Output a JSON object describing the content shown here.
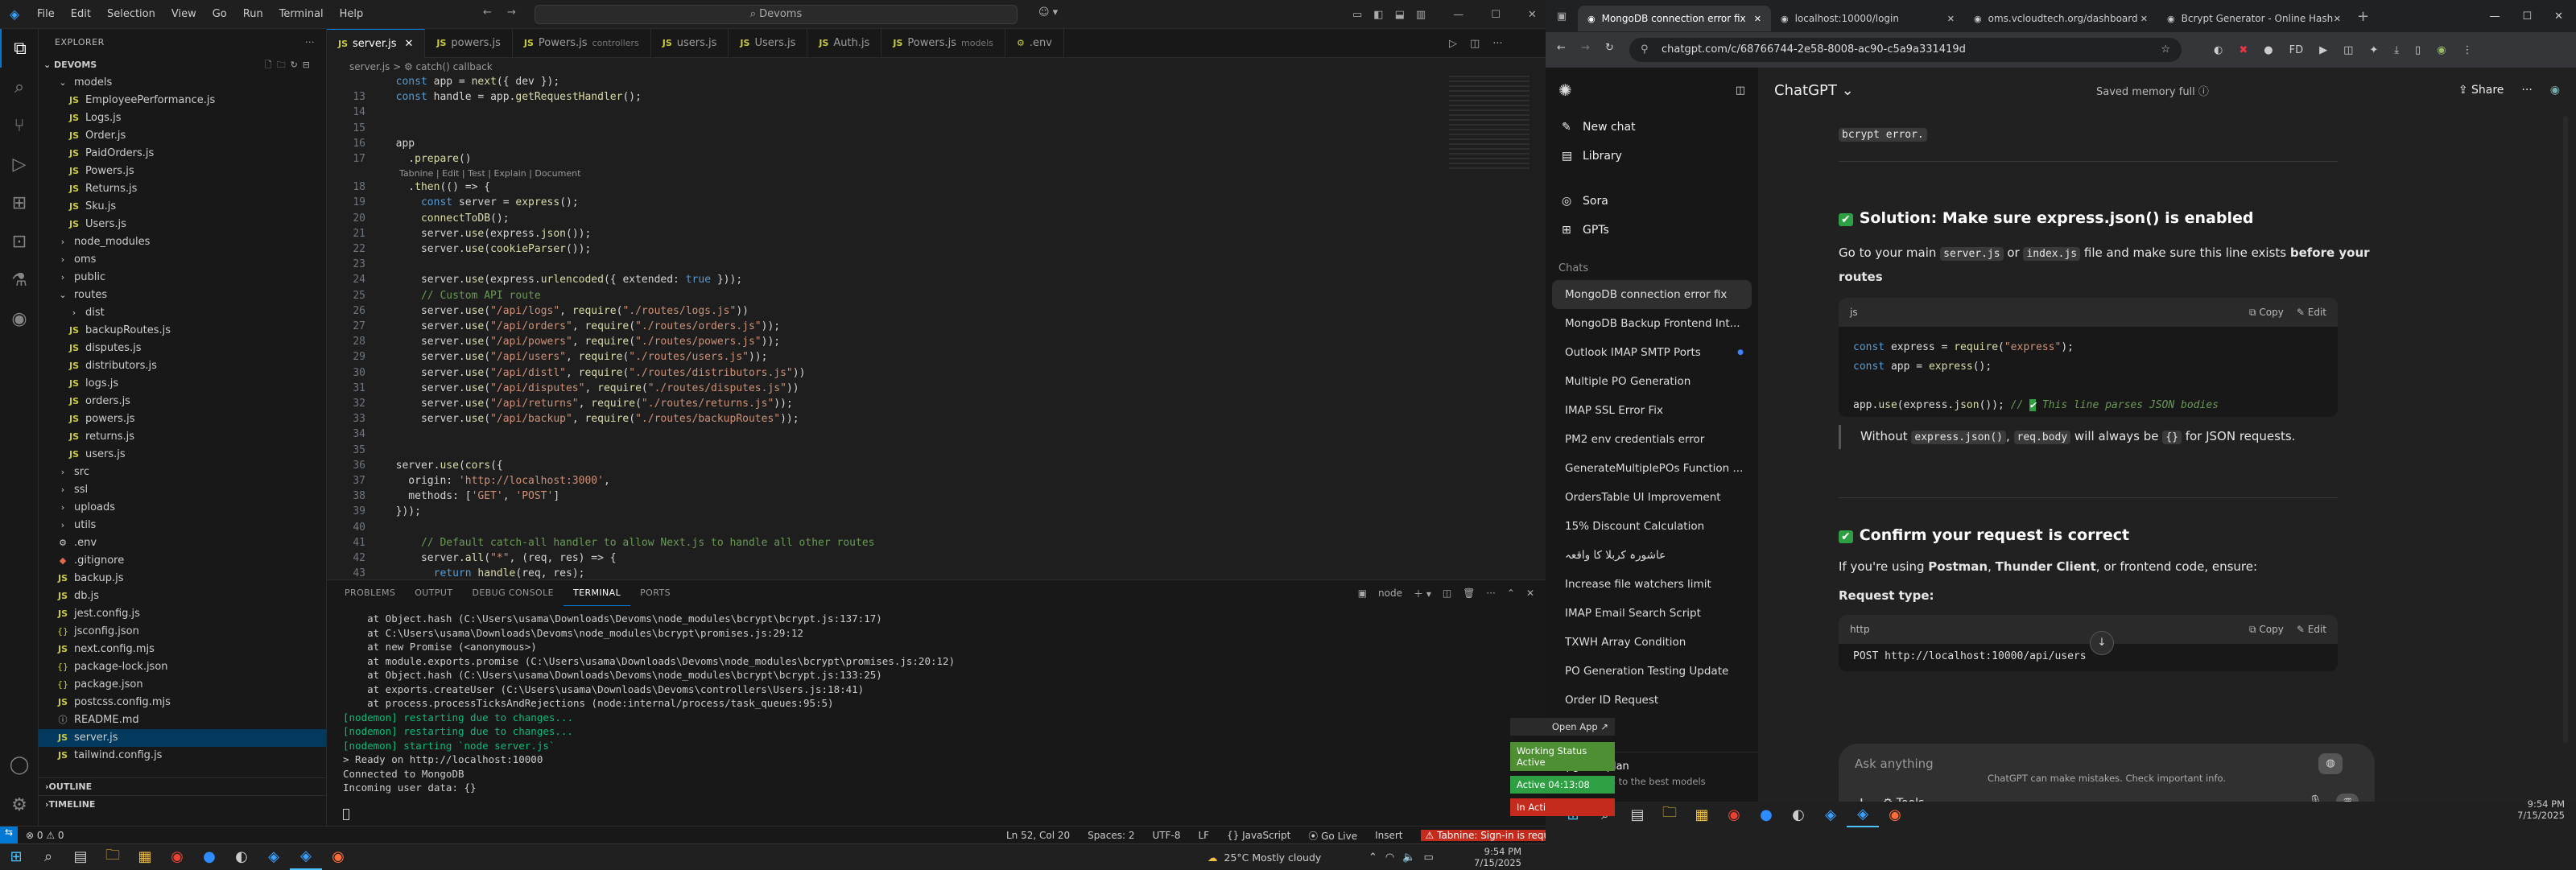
{
  "vscode": {
    "menu": [
      "File",
      "Edit",
      "Selection",
      "View",
      "Go",
      "Run",
      "Terminal",
      "Help"
    ],
    "search": "Devoms",
    "explorer_title": "EXPLORER",
    "root": "DEVOMS",
    "tree": [
      {
        "indent": 1,
        "type": "folder",
        "open": true,
        "name": "models"
      },
      {
        "indent": 2,
        "type": "js",
        "name": "EmployeePerformance.js"
      },
      {
        "indent": 2,
        "type": "js",
        "name": "Logs.js"
      },
      {
        "indent": 2,
        "type": "js",
        "name": "Order.js"
      },
      {
        "indent": 2,
        "type": "js",
        "name": "PaidOrders.js"
      },
      {
        "indent": 2,
        "type": "js",
        "name": "Powers.js"
      },
      {
        "indent": 2,
        "type": "js",
        "name": "Returns.js"
      },
      {
        "indent": 2,
        "type": "js",
        "name": "Sku.js"
      },
      {
        "indent": 2,
        "type": "js",
        "name": "Users.js"
      },
      {
        "indent": 1,
        "type": "folder",
        "open": false,
        "name": "node_modules"
      },
      {
        "indent": 1,
        "type": "folder",
        "open": false,
        "name": "oms"
      },
      {
        "indent": 1,
        "type": "folder",
        "open": false,
        "name": "public"
      },
      {
        "indent": 1,
        "type": "folder",
        "open": true,
        "name": "routes"
      },
      {
        "indent": 2,
        "type": "folder",
        "open": false,
        "name": "dist"
      },
      {
        "indent": 2,
        "type": "js",
        "name": "backupRoutes.js"
      },
      {
        "indent": 2,
        "type": "js",
        "name": "disputes.js"
      },
      {
        "indent": 2,
        "type": "js",
        "name": "distributors.js"
      },
      {
        "indent": 2,
        "type": "js",
        "name": "logs.js"
      },
      {
        "indent": 2,
        "type": "js",
        "name": "orders.js"
      },
      {
        "indent": 2,
        "type": "js",
        "name": "powers.js"
      },
      {
        "indent": 2,
        "type": "js",
        "name": "returns.js"
      },
      {
        "indent": 2,
        "type": "js",
        "name": "users.js"
      },
      {
        "indent": 1,
        "type": "folder",
        "open": false,
        "name": "src"
      },
      {
        "indent": 1,
        "type": "folder",
        "open": false,
        "name": "ssl"
      },
      {
        "indent": 1,
        "type": "folder",
        "open": false,
        "name": "uploads"
      },
      {
        "indent": 1,
        "type": "folder",
        "open": false,
        "name": "utils"
      },
      {
        "indent": 1,
        "type": "env",
        "name": ".env"
      },
      {
        "indent": 1,
        "type": "git",
        "name": ".gitignore"
      },
      {
        "indent": 1,
        "type": "js",
        "name": "backup.js"
      },
      {
        "indent": 1,
        "type": "js",
        "name": "db.js"
      },
      {
        "indent": 1,
        "type": "js",
        "name": "jest.config.js"
      },
      {
        "indent": 1,
        "type": "json",
        "name": "jsconfig.json"
      },
      {
        "indent": 1,
        "type": "js",
        "name": "next.config.mjs"
      },
      {
        "indent": 1,
        "type": "json",
        "name": "package-lock.json"
      },
      {
        "indent": 1,
        "type": "json",
        "name": "package.json"
      },
      {
        "indent": 1,
        "type": "js",
        "name": "postcss.config.mjs"
      },
      {
        "indent": 1,
        "type": "md",
        "name": "README.md"
      },
      {
        "indent": 1,
        "type": "js",
        "name": "server.js",
        "selected": true
      },
      {
        "indent": 1,
        "type": "js",
        "name": "tailwind.config.js"
      }
    ],
    "outline": "OUTLINE",
    "timeline": "TIMELINE",
    "tabs": [
      {
        "name": "server.js",
        "active": true,
        "sub": ""
      },
      {
        "name": "powers.js",
        "sub": ""
      },
      {
        "name": "Powers.js",
        "sub": "controllers"
      },
      {
        "name": "users.js",
        "sub": ""
      },
      {
        "name": "Users.js",
        "sub": ""
      },
      {
        "name": "Auth.js",
        "sub": ""
      },
      {
        "name": "Powers.js",
        "sub": "models"
      },
      {
        "name": ".env",
        "sub": ""
      }
    ],
    "breadcrumb": "server.js  >  ⚙ catch() callback",
    "codelens": "Tabnine | Edit | Test | Explain | Document",
    "code": [
      {
        "n": "",
        "t": "  const app = next({ dev });"
      },
      {
        "n": "13",
        "t": "  const handle = app.getRequestHandler();"
      },
      {
        "n": "14",
        "t": ""
      },
      {
        "n": "15",
        "t": ""
      },
      {
        "n": "16",
        "t": "  app"
      },
      {
        "n": "17",
        "t": "    .prepare()"
      },
      {
        "n": "18",
        "t": "    .then(() => {"
      },
      {
        "n": "19",
        "t": "      const server = express();"
      },
      {
        "n": "20",
        "t": "      connectToDB();"
      },
      {
        "n": "21",
        "t": "      server.use(express.json());"
      },
      {
        "n": "22",
        "t": "      server.use(cookieParser());"
      },
      {
        "n": "23",
        "t": ""
      },
      {
        "n": "24",
        "t": "      server.use(express.urlencoded({ extended: true }));"
      },
      {
        "n": "25",
        "t": "      // Custom API route"
      },
      {
        "n": "26",
        "t": "      server.use(\"/api/logs\", require(\"./routes/logs.js\"))"
      },
      {
        "n": "27",
        "t": "      server.use(\"/api/orders\", require(\"./routes/orders.js\"));"
      },
      {
        "n": "28",
        "t": "      server.use(\"/api/powers\", require(\"./routes/powers.js\"));"
      },
      {
        "n": "29",
        "t": "      server.use(\"/api/users\", require(\"./routes/users.js\"));"
      },
      {
        "n": "30",
        "t": "      server.use(\"/api/distl\", require(\"./routes/distributors.js\"))"
      },
      {
        "n": "31",
        "t": "      server.use(\"/api/disputes\", require(\"./routes/disputes.js\"))"
      },
      {
        "n": "32",
        "t": "      server.use(\"/api/returns\", require(\"./routes/returns.js\"));"
      },
      {
        "n": "33",
        "t": "      server.use(\"/api/backup\", require(\"./routes/backupRoutes\"));"
      },
      {
        "n": "34",
        "t": ""
      },
      {
        "n": "35",
        "t": ""
      },
      {
        "n": "36",
        "t": "  server.use(cors({"
      },
      {
        "n": "37",
        "t": "    origin: 'http://localhost:3000',"
      },
      {
        "n": "38",
        "t": "    methods: ['GET', 'POST']"
      },
      {
        "n": "39",
        "t": "  }));"
      },
      {
        "n": "40",
        "t": ""
      },
      {
        "n": "41",
        "t": "      // Default catch-all handler to allow Next.js to handle all other routes"
      },
      {
        "n": "42",
        "t": "      server.all(\"*\", (req, res) => {"
      },
      {
        "n": "43",
        "t": "        return handle(req, res);"
      }
    ],
    "panel_tabs": [
      "PROBLEMS",
      "OUTPUT",
      "DEBUG CONSOLE",
      "TERMINAL",
      "PORTS"
    ],
    "panel_active": "TERMINAL",
    "terminal_label": "node",
    "terminal": [
      "    at Object.hash (C:\\Users\\usama\\Downloads\\Devoms\\node_modules\\bcrypt\\bcrypt.js:137:17)",
      "    at C:\\Users\\usama\\Downloads\\Devoms\\node_modules\\bcrypt\\promises.js:29:12",
      "    at new Promise (<anonymous>)",
      "    at module.exports.promise (C:\\Users\\usama\\Downloads\\Devoms\\node_modules\\bcrypt\\promises.js:20:12)",
      "    at Object.hash (C:\\Users\\usama\\Downloads\\Devoms\\node_modules\\bcrypt\\bcrypt.js:133:25)",
      "    at exports.createUser (C:\\Users\\usama\\Downloads\\Devoms\\controllers\\Users.js:18:41)",
      "    at process.processTicksAndRejections (node:internal/process/task_queues:95:5)",
      "[nodemon] restarting due to changes...",
      "[nodemon] restarting due to changes...",
      "[nodemon] starting `node server.js`",
      "> Ready on http://localhost:10000",
      "Connected to MongoDB",
      "Incoming user data: {}"
    ],
    "status": {
      "errors": "⊗ 0  ⚠ 0",
      "pos": "Ln 52, Col 20",
      "spaces": "Spaces: 2",
      "enc": "UTF-8",
      "eol": "LF",
      "lang": "{} JavaScript",
      "golive": "Go Live",
      "insert": "Insert",
      "tabnine": "Tabnine: Sign-in is required"
    },
    "toast": {
      "open": "Open App ↗",
      "working": "Working Status Active",
      "active": "Active 04:13:08",
      "inactive": "In Acti"
    }
  },
  "taskbar_left": {
    "weather": "25°C  Mostly cloudy",
    "time": "9:54 PM",
    "date": "7/15/2025"
  },
  "browser": {
    "tabs": [
      {
        "title": "MongoDB connection error fix",
        "active": true
      },
      {
        "title": "localhost:10000/login"
      },
      {
        "title": "oms.vcloudtech.org/dashboard"
      },
      {
        "title": "Bcrypt Generator - Online Hash"
      }
    ],
    "url": "chatgpt.com/c/68766744-2e58-8008-ac90-c5a9a331419d",
    "side": {
      "new_chat": "New chat",
      "library": "Library",
      "sora": "Sora",
      "gpts": "GPTs",
      "chats_label": "Chats",
      "chats": [
        "MongoDB connection error fix",
        "MongoDB Backup Frontend Int...",
        "Outlook IMAP SMTP Ports",
        "Multiple PO Generation",
        "IMAP SSL Error Fix",
        "PM2 env credentials error",
        "GenerateMultiplePOs Function ...",
        "OrdersTable UI Improvement",
        "15% Discount Calculation",
        "عاشورہ کربلا کا واقعہ",
        "Increase file watchers limit",
        "IMAP Email Search Script",
        "TXWH Array Condition",
        "PO Generation Testing Update",
        "Order ID Request"
      ],
      "upgrade": "Upgrade plan",
      "upgrade_sub": "More access to the best models"
    },
    "header": {
      "model": "ChatGPT ⌄",
      "memory": "Saved memory full ⓘ",
      "share": "Share"
    },
    "content": {
      "top_tail": "bcrypt error.",
      "h1": "Solution: Make sure express.json() is enabled",
      "p1a": "Go to your main ",
      "p1b": "server.js",
      "p1c": " or ",
      "p1d": "index.js",
      "p1e": " file and make sure this line exists ",
      "p1f": "before your routes",
      "code1_lang": "js",
      "copy": "Copy",
      "edit": "Edit",
      "code1": [
        "const express = require(\"express\");",
        "const app = express();",
        "",
        "app.use(express.json()); // ✅ This line parses JSON bodies"
      ],
      "quote_a": "Without ",
      "quote_b": "express.json()",
      "quote_c": ", ",
      "quote_d": "req.body",
      "quote_e": " will always be ",
      "quote_f": "{}",
      "quote_g": " for JSON requests.",
      "h2": "Confirm your request is correct",
      "p2a": "If you're using ",
      "p2b": "Postman",
      "p2c": ", ",
      "p2d": "Thunder Client",
      "p2e": ", or frontend code, ensure:",
      "req_type": "Request type:",
      "code2_lang": "http",
      "code2": "POST http://localhost:10000/api/users",
      "ask": "Ask anything",
      "tools": "Tools",
      "disclaimer": "ChatGPT can make mistakes. Check important info."
    }
  },
  "taskbar_right": {
    "time": "9:54 PM",
    "date": "7/15/2025"
  },
  "colors": {
    "accent": "#0078d4",
    "check": "#2ea043",
    "tab_error": "#c42b1c"
  }
}
